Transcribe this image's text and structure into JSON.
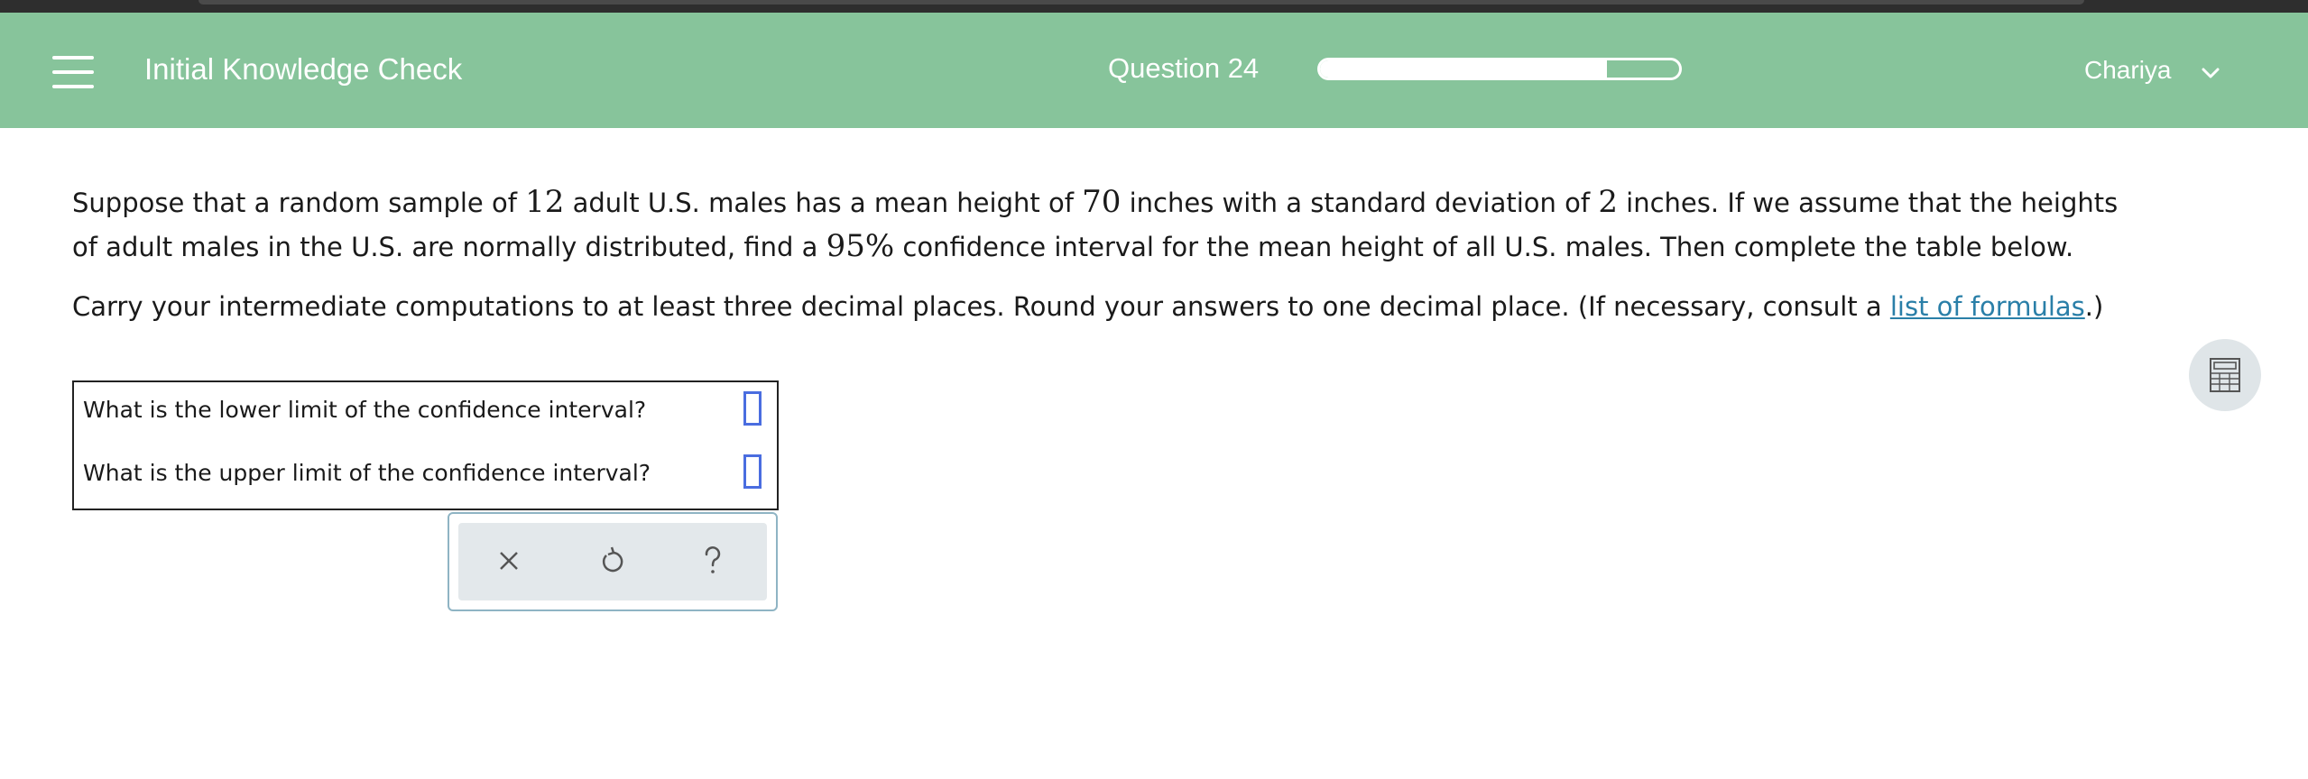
{
  "header": {
    "app_title": "Initial Knowledge Check",
    "question_label": "Question 24",
    "progress_fraction": 0.8,
    "user_name": "Chariya"
  },
  "problem": {
    "p1_a": "Suppose that a random sample of ",
    "n": "12",
    "p1_b": " adult U.S. males has a mean height of ",
    "mean": "70",
    "p1_c": " inches with a standard deviation of ",
    "sd": "2",
    "p1_d": " inches. If we assume that the heights of adult males in the U.S. are normally distributed, find a ",
    "conf": "95%",
    "p1_e": " confidence interval for the mean height of all U.S. males. Then complete the table below.",
    "p2_a": "Carry your intermediate computations to at least three decimal places. Round your answers to one decimal place. (If necessary, consult a ",
    "link_text": "list of formulas",
    "p2_b": ".)"
  },
  "table": {
    "rows": [
      {
        "question": "What is the lower limit of the confidence interval?",
        "value": ""
      },
      {
        "question": "What is the upper limit of the confidence interval?",
        "value": ""
      }
    ]
  },
  "toolbar": {
    "icons": [
      "close-icon",
      "undo-icon",
      "help-icon"
    ]
  },
  "colors": {
    "header_bg": "#87c49b",
    "link": "#2a7fa8",
    "answer_box_border": "#4a6de0"
  }
}
